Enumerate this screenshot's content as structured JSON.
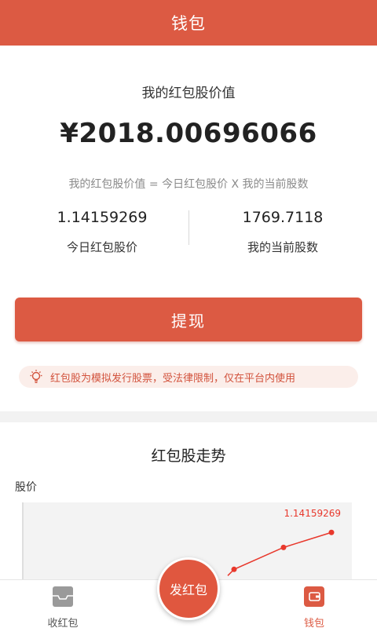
{
  "header": {
    "title": "钱包"
  },
  "summary": {
    "caption": "我的红包股价值",
    "amount": "¥2018.00696066",
    "formula": "我的红包股价值 = 今日红包股价 X 我的当前股数",
    "price": {
      "value": "1.14159269",
      "label": "今日红包股价"
    },
    "shares": {
      "value": "1769.7118",
      "label": "我的当前股数"
    }
  },
  "actions": {
    "withdraw_label": "提现"
  },
  "notice": {
    "icon": "lightbulb-icon",
    "text": "红包股为模拟发行股票，受法律限制，仅在平台内使用"
  },
  "trend": {
    "title": "红包股走势",
    "axis_label": "股价",
    "latest_label": "1.14159269"
  },
  "chart_data": {
    "type": "line",
    "title": "红包股走势",
    "ylabel": "股价",
    "series": [
      {
        "values": [
          1.1384,
          1.1403,
          1.1416
        ]
      }
    ],
    "annotations": [
      "1.14159269"
    ],
    "color": "#e8382c"
  },
  "bottom_nav": {
    "receive": {
      "label": "收红包",
      "icon": "inbox-icon"
    },
    "send": {
      "label": "发红包"
    },
    "wallet": {
      "label": "钱包",
      "icon": "wallet-icon",
      "active": true
    }
  },
  "colors": {
    "primary": "#dc5a43",
    "accent_red": "#e8382c",
    "notice_bg": "#fbeeea"
  }
}
